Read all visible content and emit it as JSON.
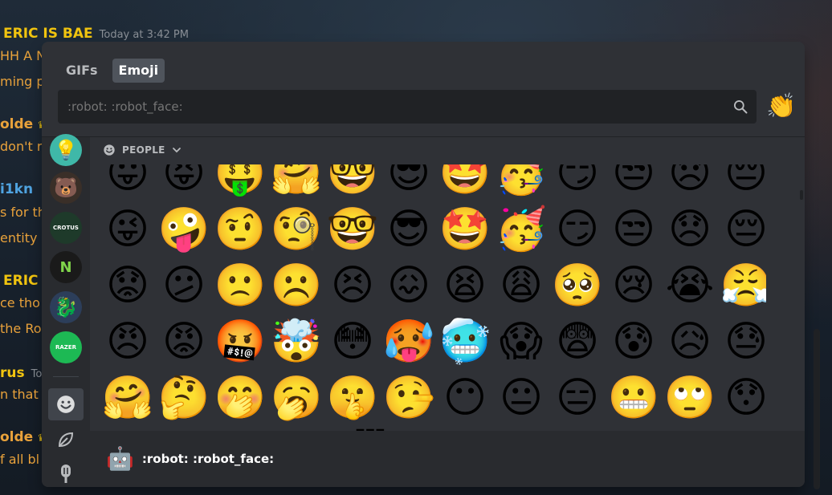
{
  "background": {
    "lines": [
      {
        "user": "ERIC IS BAE",
        "timestamp": "Today at 3:42 PM"
      },
      {
        "text": "HH A N"
      },
      {
        "text": "ming p"
      },
      {
        "user": "olde",
        "crown": "♛"
      },
      {
        "text": "don't r"
      },
      {
        "user": "i1kn"
      },
      {
        "text": "s for th"
      },
      {
        "text": "entity"
      },
      {
        "user": "ERIC I"
      },
      {
        "text": "ce tho"
      },
      {
        "text": "the Ro"
      },
      {
        "user": "rus",
        "timestamp": "To"
      },
      {
        "text": "n that v"
      },
      {
        "user": "olde",
        "crown": "♛"
      },
      {
        "text": "f all bl"
      }
    ]
  },
  "tabs": [
    {
      "label": "GIFs",
      "active": false
    },
    {
      "label": "Emoji",
      "active": true
    }
  ],
  "search": {
    "placeholder": ":robot: :robot_face:",
    "icon": "search-icon"
  },
  "random_emoji_button": "👏",
  "category": {
    "label": "PEOPLE",
    "icon": "smiley-icon",
    "chevron": "chevron-down-icon"
  },
  "rail": {
    "servers": [
      {
        "name": "lightbulb-server",
        "glyph": "💡",
        "bg": "#3fb8a8"
      },
      {
        "name": "bear-server",
        "glyph": "🐻",
        "bg": "#3a2f28"
      },
      {
        "name": "crotus-server",
        "glyph": "CROTUS",
        "bg": "#1e3a2a"
      },
      {
        "name": "n-server",
        "glyph": "N",
        "bg": "#1a1a1a"
      },
      {
        "name": "dragon-server",
        "glyph": "🐉",
        "bg": "#2c3e5a"
      },
      {
        "name": "razer-server",
        "glyph": "RAZER",
        "bg": "#1db954"
      }
    ],
    "categories": [
      {
        "name": "people-category",
        "glyph": "☺",
        "active": true
      },
      {
        "name": "nature-category",
        "glyph": "🍃",
        "active": false
      },
      {
        "name": "food-category",
        "glyph": "🍦",
        "active": false
      }
    ]
  },
  "emoji_rows": [
    [
      "😛",
      "😝",
      "🤑",
      "🤗",
      "🤓",
      "😎",
      "🤩",
      "🥳",
      "😏",
      "😒",
      "😞",
      "😔"
    ],
    [
      "😜",
      "🤪",
      "🤨",
      "🧐",
      "🤓",
      "😎",
      "🤩",
      "🥳",
      "😏",
      "😒",
      "😞",
      "😔"
    ],
    [
      "😟",
      "😕",
      "🙁",
      "☹️",
      "😣",
      "😖",
      "😫",
      "😩",
      "🥺",
      "😢",
      "😭",
      "😤"
    ],
    [
      "😠",
      "😡",
      "🤬",
      "🤯",
      "😳",
      "🥵",
      "🥶",
      "😱",
      "😨",
      "😰",
      "😥",
      "😓"
    ],
    [
      "🤗",
      "🤔",
      "🤭",
      "🥱",
      "🤫",
      "🤥",
      "😶",
      "😐",
      "😑",
      "😬",
      "🙄",
      "😯"
    ],
    [
      "😦",
      "😧",
      "😮",
      "😲",
      "😴",
      "🤤",
      "😪",
      "😵",
      "🤐",
      "🥴",
      "🤢",
      "🤮"
    ]
  ],
  "preview": {
    "emoji": "🤖",
    "name": ":robot: :robot_face:"
  }
}
